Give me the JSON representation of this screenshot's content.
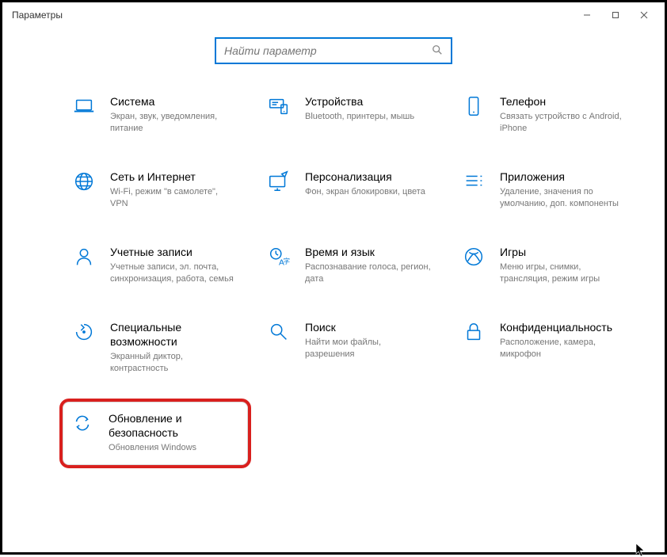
{
  "window": {
    "title": "Параметры"
  },
  "search": {
    "placeholder": "Найти параметр"
  },
  "tiles": [
    {
      "id": "system",
      "title": "Система",
      "desc": "Экран, звук, уведомления, питание"
    },
    {
      "id": "devices",
      "title": "Устройства",
      "desc": "Bluetooth, принтеры, мышь"
    },
    {
      "id": "phone",
      "title": "Телефон",
      "desc": "Связать устройство с Android, iPhone"
    },
    {
      "id": "network",
      "title": "Сеть и Интернет",
      "desc": "Wi-Fi, режим \"в самолете\", VPN"
    },
    {
      "id": "personalization",
      "title": "Персонализация",
      "desc": "Фон, экран блокировки, цвета"
    },
    {
      "id": "apps",
      "title": "Приложения",
      "desc": "Удаление, значения по умолчанию, доп. компоненты"
    },
    {
      "id": "accounts",
      "title": "Учетные записи",
      "desc": "Учетные записи, эл. почта, синхронизация, работа, семья"
    },
    {
      "id": "time",
      "title": "Время и язык",
      "desc": "Распознавание голоса, регион, дата"
    },
    {
      "id": "gaming",
      "title": "Игры",
      "desc": "Меню игры, снимки, трансляция, режим игры"
    },
    {
      "id": "ease",
      "title": "Специальные возможности",
      "desc": "Экранный диктор, контрастность"
    },
    {
      "id": "search",
      "title": "Поиск",
      "desc": "Найти мои файлы, разрешения"
    },
    {
      "id": "privacy",
      "title": "Конфиденциальность",
      "desc": "Расположение, камера, микрофон"
    },
    {
      "id": "update",
      "title": "Обновление и безопасность",
      "desc": "Обновления Windows"
    }
  ]
}
